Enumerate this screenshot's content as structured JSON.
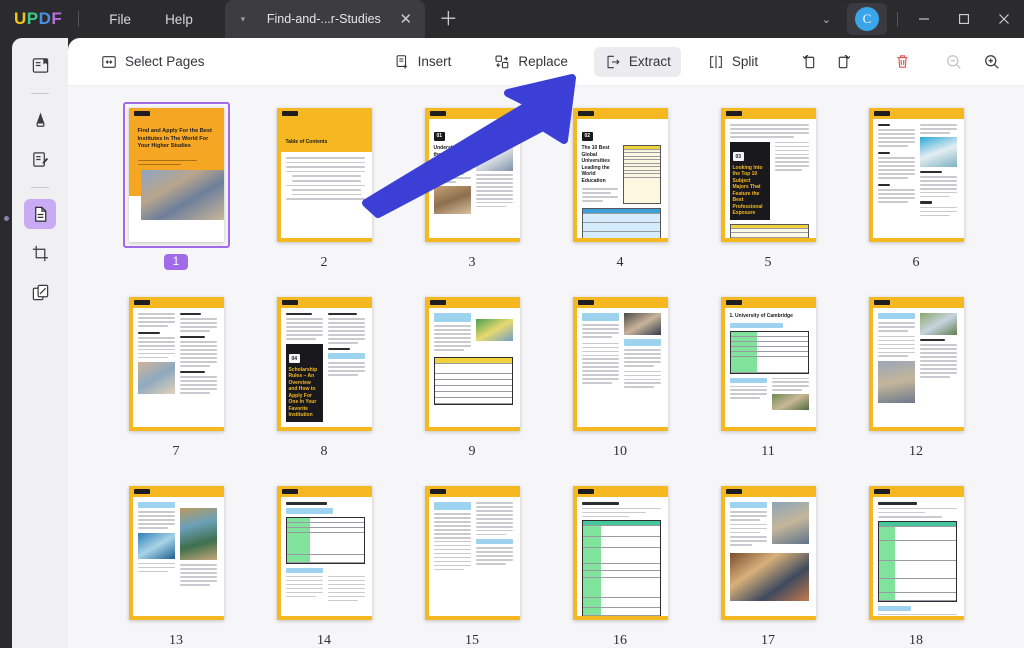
{
  "window": {
    "app_name": "UPDF",
    "logo_letters": [
      "U",
      "P",
      "D",
      "F"
    ],
    "menus": [
      "File",
      "Help"
    ],
    "tab_title": "Find-and-...r-Studies",
    "tab_caret_icon": "chevron-down-icon",
    "tab_close_icon": "close-icon",
    "new_tab_icon": "plus-icon",
    "account_initial": "C",
    "controls": {
      "chevron": "⌄",
      "minimize": "—",
      "maximize": "▢",
      "close": "✕"
    },
    "accent_purple": "#a06ae8",
    "accent_yellow": "#f5b821",
    "arrow_color": "#3b3fd6"
  },
  "sidebar": {
    "items": [
      {
        "name": "reader-view",
        "icon": "book-page-icon",
        "active": false
      },
      {
        "name": "annotate-highlighter",
        "icon": "highlighter-pen-icon",
        "active": false
      },
      {
        "name": "edit-pdf",
        "icon": "document-pencil-icon",
        "active": false
      },
      {
        "name": "organize-pages",
        "icon": "pages-icon",
        "active": true
      },
      {
        "name": "crop-page",
        "icon": "crop-icon",
        "active": false
      },
      {
        "name": "batch-process",
        "icon": "copy-pages-icon",
        "active": false
      }
    ]
  },
  "toolbar": {
    "select_pages": "Select Pages",
    "select_pages_icon": "select-pages-icon",
    "insert": "Insert",
    "insert_icon": "insert-page-icon",
    "replace": "Replace",
    "replace_icon": "replace-page-icon",
    "extract": "Extract",
    "extract_icon": "extract-page-icon",
    "split": "Split",
    "split_icon": "split-page-icon",
    "rotate_left_icon": "rotate-left-icon",
    "rotate_right_icon": "rotate-right-icon",
    "delete_icon": "trash-icon",
    "zoom_out_icon": "zoom-out-icon",
    "zoom_in_icon": "zoom-in-icon"
  },
  "pages": [
    {
      "number": "1",
      "selected": true,
      "layout": "cover",
      "title": "Find and Apply For the Best Institutes In The World For Your Higher Studies"
    },
    {
      "number": "2",
      "selected": false,
      "layout": "toc",
      "title": "Table of Contents"
    },
    {
      "number": "3",
      "selected": false,
      "layout": "chapter-img",
      "chapter": "01",
      "title": "Understanding the M..."
    },
    {
      "number": "4",
      "selected": false,
      "layout": "chapter-table-blue",
      "chapter": "02",
      "title": "The 10 Best Global Universities Leading the World Education"
    },
    {
      "number": "5",
      "selected": false,
      "layout": "chapter-table-yellow",
      "chapter": "03",
      "title": "Looking Into the Top 10 Subject Majors That Feature the Best Professional Exposure"
    },
    {
      "number": "6",
      "selected": false,
      "layout": "twocol-img-right",
      "title": ""
    },
    {
      "number": "7",
      "selected": false,
      "layout": "twocol-img-left",
      "title": ""
    },
    {
      "number": "8",
      "selected": false,
      "layout": "chapter-right",
      "chapter": "04",
      "title": "Scholarship Rules – An Overview and How to Apply For One In Your Favorite Institution"
    },
    {
      "number": "9",
      "selected": false,
      "layout": "blue-img-table",
      "title": ""
    },
    {
      "number": "10",
      "selected": false,
      "layout": "blue-list-img",
      "title": ""
    },
    {
      "number": "11",
      "selected": false,
      "layout": "green-table-photo",
      "title": "1. University of Cambridge"
    },
    {
      "number": "12",
      "selected": false,
      "layout": "two-photos",
      "title": ""
    },
    {
      "number": "13",
      "selected": false,
      "layout": "two-photos-b",
      "title": ""
    },
    {
      "number": "14",
      "selected": false,
      "layout": "green-table",
      "title": ""
    },
    {
      "number": "15",
      "selected": false,
      "layout": "text-twocol",
      "title": ""
    },
    {
      "number": "16",
      "selected": false,
      "layout": "teal-table",
      "title": ""
    },
    {
      "number": "17",
      "selected": false,
      "layout": "photo-stack",
      "title": ""
    },
    {
      "number": "18",
      "selected": false,
      "layout": "green-table-wide",
      "title": ""
    }
  ]
}
